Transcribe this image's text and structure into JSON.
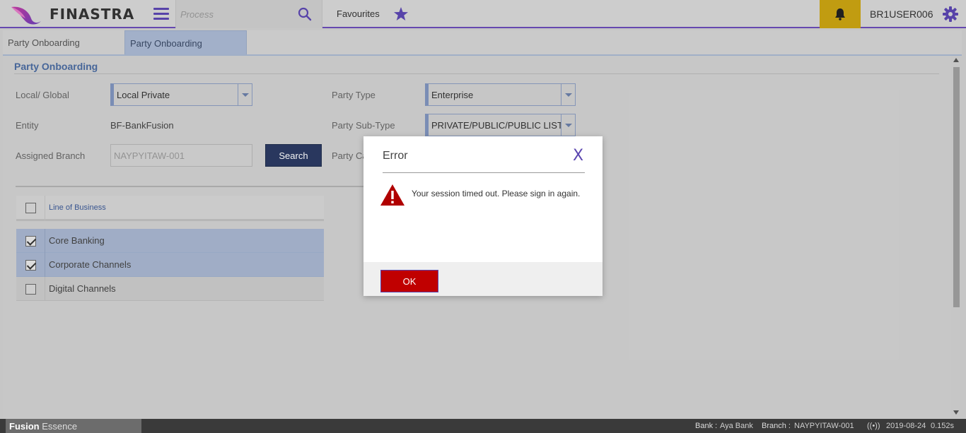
{
  "app": {
    "brand": "FINASTRA",
    "process_placeholder": "Process",
    "favourites_label": "Favourites",
    "username": "BR1USER006"
  },
  "tabs": [
    {
      "label": "Party Onboarding",
      "active": false
    },
    {
      "label": "Party Onboarding",
      "active": true
    }
  ],
  "form": {
    "section_title": "Party Onboarding",
    "local_global_label": "Local/ Global",
    "local_global_value": "Local Private",
    "entity_label": "Entity",
    "entity_value": "BF-BankFusion",
    "assigned_branch_label": "Assigned Branch",
    "assigned_branch_value": "NAYPYITAW-001",
    "search_button": "Search",
    "party_type_label": "Party Type",
    "party_type_value": "Enterprise",
    "party_subtype_label": "Party Sub-Type",
    "party_subtype_value": "PRIVATE/PUBLIC/PUBLIC LISTED C",
    "party_category_label": "Party Ca"
  },
  "table": {
    "header": "Line of Business",
    "rows": [
      {
        "label": "Core Banking",
        "checked": true
      },
      {
        "label": "Corporate Channels",
        "checked": true
      },
      {
        "label": "Digital Channels",
        "checked": false
      }
    ]
  },
  "dialog": {
    "title": "Error",
    "close_label": "X",
    "message": "Your session timed out. Please sign in again.",
    "ok_label": "OK"
  },
  "status_bar": {
    "product_bold": "Fusion",
    "product_rest": "Essence",
    "bank_label": "Bank :",
    "bank_value": "Aya Bank",
    "branch_label": "Branch :",
    "branch_value": "NAYPYITAW-001",
    "signal": "((•))",
    "date": "2019-08-24",
    "time": "0.152s"
  },
  "colors": {
    "accent": "#5b46b0",
    "bell_bg": "#c9a312",
    "ok_button": "#c00000",
    "search_button": "#2b3a62"
  }
}
